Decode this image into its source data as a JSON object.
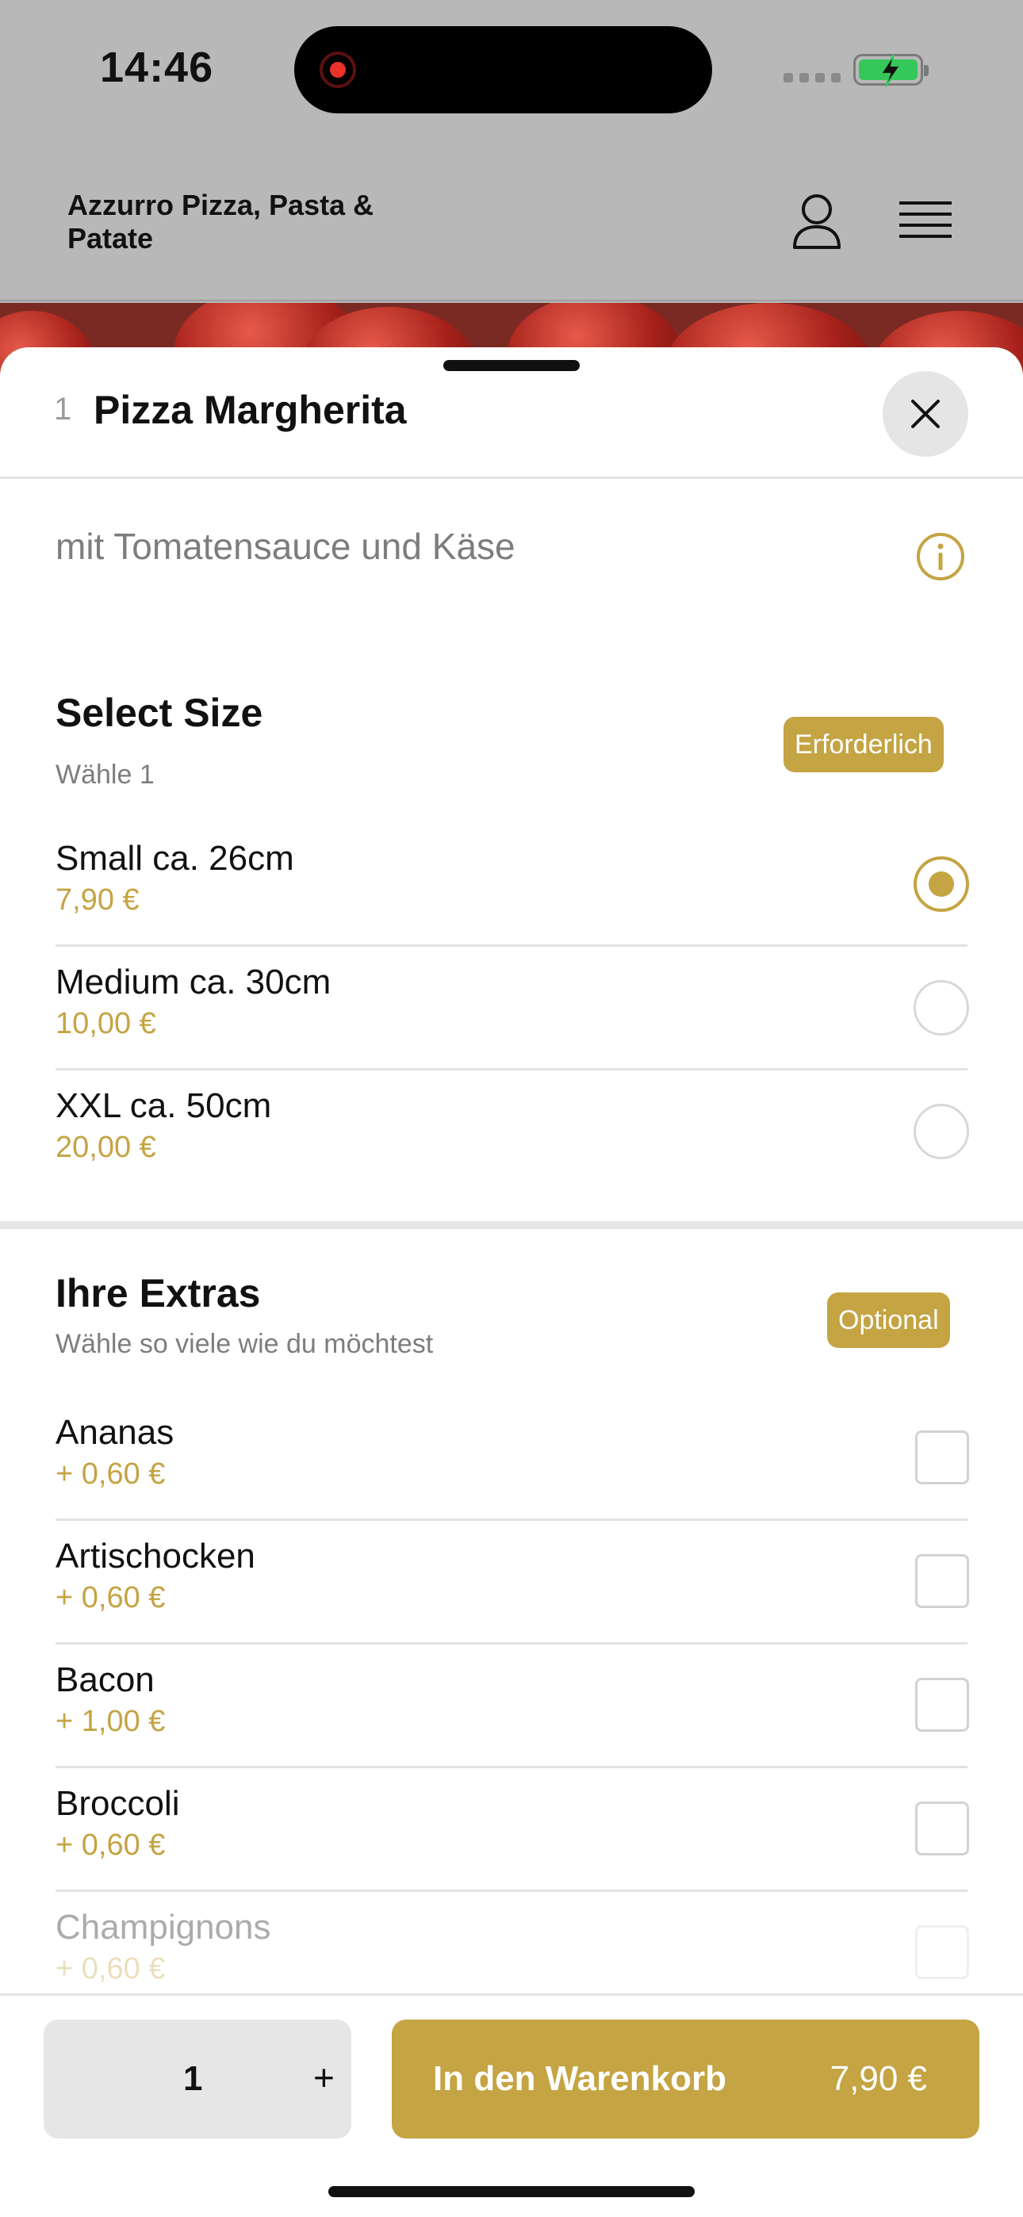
{
  "status_bar": {
    "time": "14:46"
  },
  "header": {
    "brand": "Azzurro Pizza, Pasta & Patate"
  },
  "sheet": {
    "item_number": "1",
    "item_title": "Pizza Margherita",
    "description": "mit Tomatensauce und Käse"
  },
  "size_section": {
    "title": "Select Size",
    "subtitle": "Wähle 1",
    "badge": "Erforderlich",
    "options": [
      {
        "name": "Small ca. 26cm",
        "price": "7,90 €",
        "selected": true
      },
      {
        "name": "Medium ca. 30cm",
        "price": "10,00 €",
        "selected": false
      },
      {
        "name": "XXL ca. 50cm",
        "price": "20,00 €",
        "selected": false
      }
    ]
  },
  "extras_section": {
    "title": "Ihre Extras",
    "subtitle": "Wähle so viele wie du möchtest",
    "badge": "Optional",
    "options": [
      {
        "name": "Ananas",
        "price": "+ 0,60 €",
        "checked": false
      },
      {
        "name": "Artischocken",
        "price": "+ 0,60 €",
        "checked": false
      },
      {
        "name": "Bacon",
        "price": "+ 1,00 €",
        "checked": false
      },
      {
        "name": "Broccoli",
        "price": "+ 0,60 €",
        "checked": false
      },
      {
        "name": "Champignons",
        "price": "+ 0,60 €",
        "checked": false
      }
    ]
  },
  "bottom_bar": {
    "quantity": "1",
    "plus": "+",
    "cart_label": "In den Warenkorb",
    "cart_price": "7,90 €"
  },
  "colors": {
    "accent": "#c4a443",
    "overlay": "#b8b8b8",
    "divider": "#e2e2e2"
  }
}
